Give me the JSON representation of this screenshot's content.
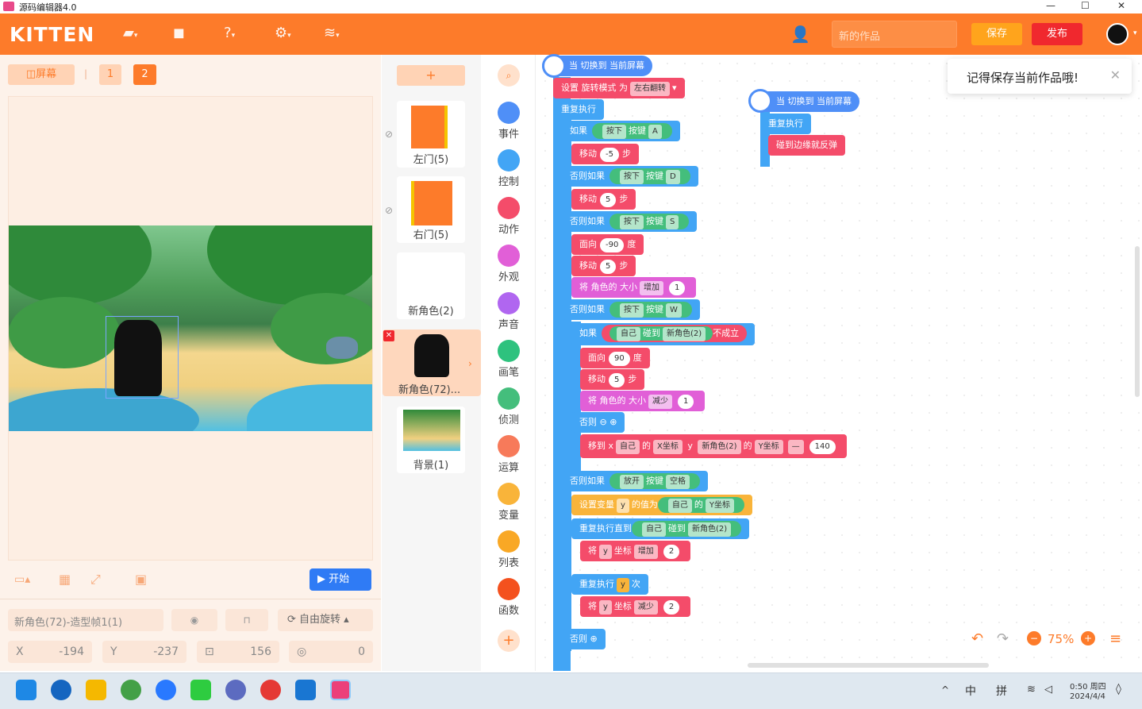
{
  "window": {
    "title": "源码编辑器4.0",
    "controls": [
      "—",
      "☐",
      "✕"
    ]
  },
  "menubar": {
    "logo": "KITTEN",
    "work_name_placeholder": "新的作品",
    "save_label": "保存",
    "publish_label": "发布"
  },
  "stage_toolbar": {
    "screen_label": "屏幕",
    "sep": "|",
    "screen_1": "1",
    "screen_2": "2"
  },
  "stage_controls": {
    "start_label": "开始"
  },
  "properties": {
    "sprite_name": "新角色(72)-造型帧1(1)",
    "rotation_label": "自由旋转",
    "x_label": "X",
    "x_value": "-194",
    "y_label": "Y",
    "y_value": "-237",
    "size_value": "156",
    "direction_value": "0"
  },
  "sprites": {
    "add_label": "+",
    "items": [
      {
        "label": "左门(5)"
      },
      {
        "label": "右门(5)"
      },
      {
        "label": "新角色(2)"
      },
      {
        "label": "新角色(72)..."
      },
      {
        "label": "背景(1)"
      }
    ]
  },
  "categories": [
    {
      "label": "事件",
      "color": "#4f8ff7",
      "icon": "event-icon"
    },
    {
      "label": "控制",
      "color": "#42a5f5",
      "icon": "control-icon"
    },
    {
      "label": "动作",
      "color": "#f44c6a",
      "icon": "motion-icon"
    },
    {
      "label": "外观",
      "color": "#e15fd7",
      "icon": "looks-icon"
    },
    {
      "label": "声音",
      "color": "#b066f0",
      "icon": "sound-icon"
    },
    {
      "label": "画笔",
      "color": "#2ec27e",
      "icon": "pen-icon"
    },
    {
      "label": "侦测",
      "color": "#44be7c",
      "icon": "sensing-icon"
    },
    {
      "label": "运算",
      "color": "#f77a5a",
      "icon": "operator-icon"
    },
    {
      "label": "变量",
      "color": "#f9b43a",
      "icon": "variable-icon"
    },
    {
      "label": "列表",
      "color": "#f9a825",
      "icon": "list-icon"
    },
    {
      "label": "函数",
      "color": "#f4511e",
      "icon": "function-icon"
    }
  ],
  "toast": {
    "text": "记得保存当前作品哦!"
  },
  "code": {
    "when_switch": "当 切换到 当前屏幕",
    "set_rot": "设置 旋转模式 为",
    "left_right": "左右翻转",
    "forever": "重复执行",
    "if": "如果",
    "press": "按下",
    "key": "按键",
    "key_a": "A",
    "key_d": "D",
    "key_s": "S",
    "key_w": "W",
    "key_space": "空格",
    "move": "移动",
    "step": "步",
    "n_5": "-5",
    "n5": "5",
    "else_if": "否则如果",
    "face": "面向",
    "deg": "度",
    "n_90": "-90",
    "n90": "90",
    "set_size": "将 角色的 大小",
    "inc": "增加",
    "dec": "减少",
    "n1": "1",
    "self": "自己",
    "touch": "碰到",
    "sprite2": "新角色(2)",
    "not": "不成立",
    "else": "否则",
    "goto_x": "移到 x",
    "of": "的",
    "xcoord": "X坐标",
    "y": "y",
    "ycoord": "Y坐标",
    "minus": "—",
    "n140": "140",
    "release": "放开",
    "set_var": "设置变量",
    "var_y": "y",
    "value_is": "的值为",
    "repeat_until": "重复执行直到",
    "set_coord": "将",
    "coord": "坐标",
    "n2": "2",
    "repeat": "重复执行",
    "times": "次",
    "bounce": "碰到边缘就反弹"
  },
  "zoom": {
    "value": "75%"
  },
  "taskbar": {
    "ime1": "中",
    "ime2": "拼",
    "time": "0:50 周四",
    "date": "2024/4/4"
  }
}
